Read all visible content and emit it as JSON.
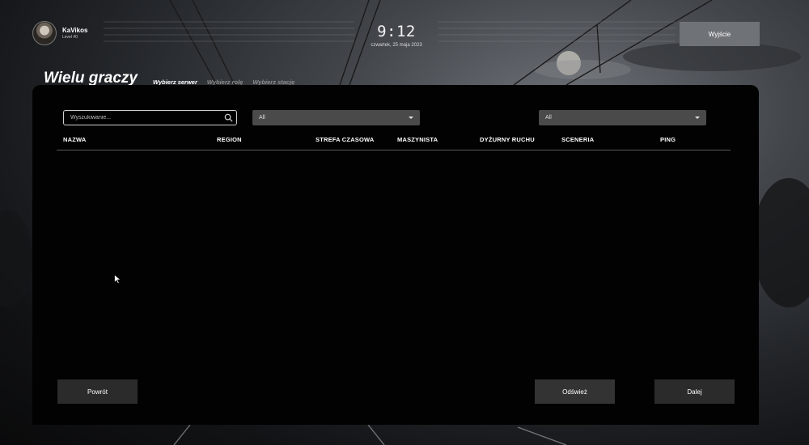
{
  "user": {
    "name": "KaVikos",
    "level": "Level #0"
  },
  "clock": {
    "time": "9:12",
    "date": "czwartek, 25 maja 2023"
  },
  "header": {
    "exit_label": "Wyjście"
  },
  "page": {
    "title": "Wielu graczy",
    "steps": [
      {
        "label": "Wybierz serwer",
        "active": true
      },
      {
        "label": "Wybierz rolę",
        "active": false
      },
      {
        "label": "Wybierz stację",
        "active": false
      }
    ]
  },
  "filters": {
    "search_placeholder": "Wyszukiwanie...",
    "select_left": "All",
    "select_right": "All"
  },
  "table": {
    "columns": [
      "NAZWA",
      "REGION",
      "STREFA CZASOWA",
      "MASZYNISTA",
      "DYŻURNY RUCHU",
      "SCENERIA",
      "PING"
    ],
    "rows": []
  },
  "footer": {
    "back_label": "Powrót",
    "refresh_label": "Odśwież",
    "next_label": "Dalej"
  },
  "colors": {
    "panel": "#020202",
    "button": "#2b2b2b",
    "exit_button": "#6f7378",
    "select": "#4a4a4a"
  }
}
